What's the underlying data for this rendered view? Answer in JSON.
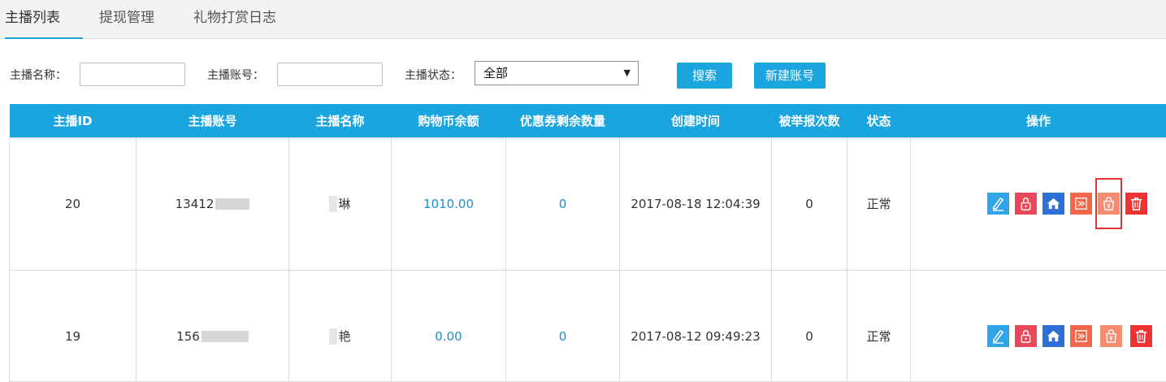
{
  "tabs": [
    {
      "label": "主播列表",
      "active": true
    },
    {
      "label": "提现管理",
      "active": false
    },
    {
      "label": "礼物打赏日志",
      "active": false
    }
  ],
  "filter": {
    "name_label": "主播名称：",
    "name_value": "",
    "account_label": "主播账号：",
    "account_value": "",
    "status_label": "主播状态：",
    "status_value": "全部",
    "search_button": "搜索",
    "new_account_button": "新建账号"
  },
  "table": {
    "headers": [
      "主播ID",
      "主播账号",
      "主播名称",
      "购物币余额",
      "优惠券剩余数量",
      "创建时间",
      "被举报次数",
      "状态",
      "操作"
    ],
    "rows": [
      {
        "id": "20",
        "account": "13412",
        "name": "琳",
        "balance": "1010.00",
        "coupons": "0",
        "created": "2017-08-18 12:04:39",
        "reports": "0",
        "status": "正常"
      },
      {
        "id": "19",
        "account": "156",
        "name": "艳",
        "balance": "0.00",
        "coupons": "0",
        "created": "2017-08-12 09:49:23",
        "reports": "0",
        "status": "正常"
      }
    ]
  },
  "colors": {
    "accent": "#1ba5df",
    "link": "#1b8fd1",
    "highlight_box": "#e03434"
  },
  "icons": [
    "edit-icon",
    "lock-icon",
    "home-icon",
    "transfer-icon",
    "gift-bag-icon",
    "trash-icon"
  ]
}
